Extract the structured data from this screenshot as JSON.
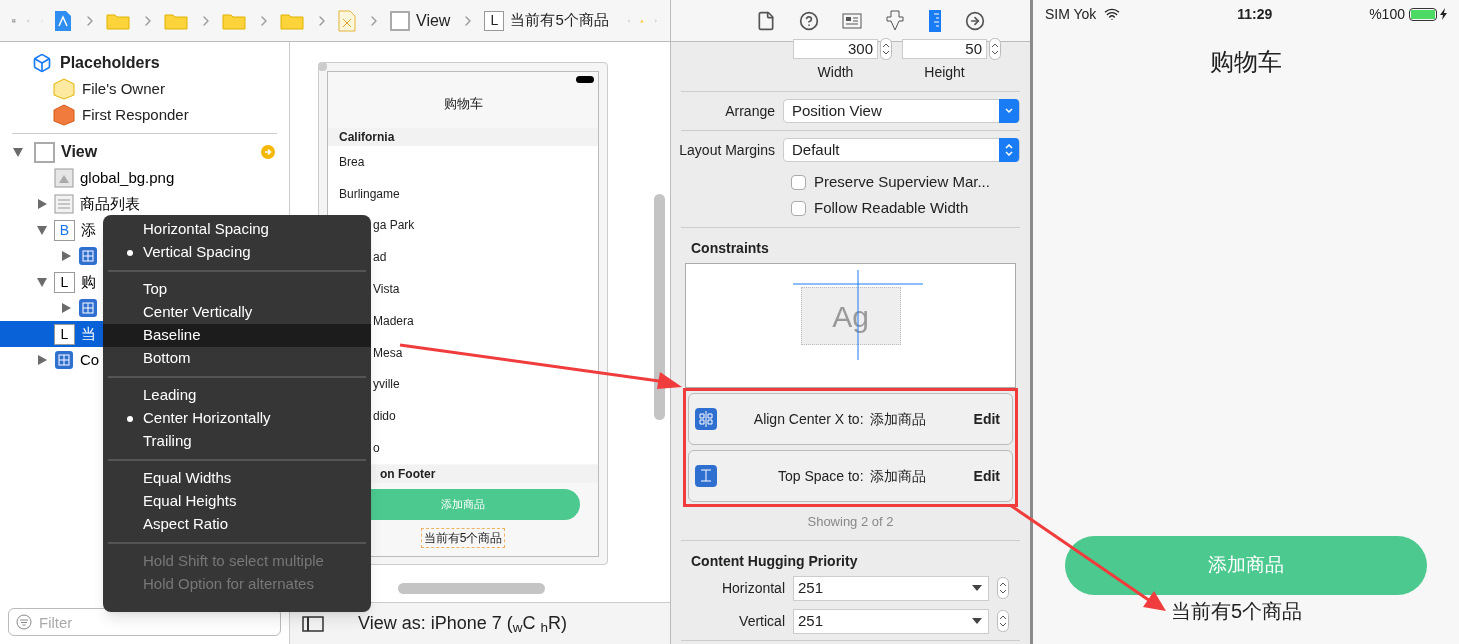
{
  "toolbar": {
    "breadcrumbs": [
      {
        "kind": "project"
      },
      {
        "kind": "folder"
      },
      {
        "kind": "folder"
      },
      {
        "kind": "folder"
      },
      {
        "kind": "folder"
      },
      {
        "kind": "xib"
      },
      {
        "kind": "view",
        "label": "View"
      },
      {
        "kind": "label",
        "badge": "L",
        "label": "当前有5个商品"
      }
    ]
  },
  "outline": {
    "placeholders": {
      "label": "Placeholders",
      "children": [
        {
          "kind": "owner",
          "label": "File's Owner"
        },
        {
          "kind": "responder",
          "label": "First Responder"
        }
      ]
    },
    "view": {
      "label": "View",
      "expanded": true,
      "children": [
        {
          "kind": "image",
          "label": "global_bg.png",
          "selected": false
        },
        {
          "kind": "table",
          "label": "商品列表",
          "expanded": false,
          "selected": false
        },
        {
          "kind": "button",
          "badge": "B",
          "label": "添",
          "expanded": true,
          "selected": false,
          "children": [
            {
              "kind": "constraints",
              "expanded": false,
              "selected": false
            }
          ]
        },
        {
          "kind": "label",
          "badge": "L",
          "label": "购",
          "expanded": true,
          "selected": false,
          "children": [
            {
              "kind": "constraints",
              "expanded": false,
              "selected": false
            }
          ]
        },
        {
          "kind": "label",
          "badge": "L",
          "label": "当",
          "selected": true
        },
        {
          "kind": "constraints",
          "label": "Co",
          "expanded": false,
          "selected": false
        }
      ]
    },
    "filter": {
      "placeholder": "Filter"
    }
  },
  "canvas": {
    "title": "购物车",
    "section_header": "California",
    "rows": [
      {
        "kind": "full",
        "text": "Brea"
      },
      {
        "kind": "full",
        "text": "Burlingame"
      },
      {
        "kind": "cut",
        "text": "ga Park"
      },
      {
        "kind": "cut",
        "text": "ad"
      },
      {
        "kind": "cut",
        "text": "Vista"
      },
      {
        "kind": "cut",
        "text": "Madera"
      },
      {
        "kind": "cut",
        "text": "Mesa"
      },
      {
        "kind": "cut",
        "text": "yville"
      },
      {
        "kind": "cut",
        "text": "dido"
      },
      {
        "kind": "cut",
        "text": "o"
      }
    ],
    "section_footer": "on Footer",
    "button": "添加商品",
    "label": "当前有5个商品",
    "view_as": "View as: iPhone 7 ($_{w}$C $_{h}$R)"
  },
  "menu": {
    "groups": [
      [
        {
          "label": "Horizontal Spacing",
          "checked": false,
          "selected": false
        },
        {
          "label": "Vertical Spacing",
          "checked": true,
          "selected": false
        }
      ],
      [
        {
          "label": "Top",
          "checked": false,
          "selected": false
        },
        {
          "label": "Center Vertically",
          "checked": false,
          "selected": false
        },
        {
          "label": "Baseline",
          "checked": false,
          "selected": true
        },
        {
          "label": "Bottom",
          "checked": false,
          "selected": false
        }
      ],
      [
        {
          "label": "Leading",
          "checked": false,
          "selected": false
        },
        {
          "label": "Center Horizontally",
          "checked": true,
          "selected": false
        },
        {
          "label": "Trailing",
          "checked": false,
          "selected": false
        }
      ],
      [
        {
          "label": "Equal Widths",
          "checked": false,
          "selected": false
        },
        {
          "label": "Equal Heights",
          "checked": false,
          "selected": false
        },
        {
          "label": "Aspect Ratio",
          "checked": false,
          "selected": false
        }
      ]
    ],
    "hints": [
      "Hold Shift to select multiple",
      "Hold Option for alternates"
    ]
  },
  "inspector": {
    "tabs": [
      {
        "kind": "file",
        "selected": false
      },
      {
        "kind": "help",
        "selected": false
      },
      {
        "kind": "identity",
        "selected": false
      },
      {
        "kind": "attributes",
        "selected": false
      },
      {
        "kind": "size",
        "selected": true
      },
      {
        "kind": "connections",
        "selected": false
      }
    ],
    "width": {
      "value": "300",
      "label": "Width"
    },
    "height": {
      "value": "50",
      "label": "Height"
    },
    "arrange": {
      "label": "Arrange",
      "value": "Position View"
    },
    "layout_margins": {
      "label": "Layout Margins",
      "value": "Default"
    },
    "checkboxes": [
      {
        "label": "Preserve Superview Mar...",
        "checked": false
      },
      {
        "label": "Follow Readable Width",
        "checked": false
      }
    ],
    "constraints_title": "Constraints",
    "preview_text": "Ag",
    "constraints": [
      {
        "kind": "center_x",
        "text": "Align Center X to:",
        "target": "添加商品",
        "action": "Edit"
      },
      {
        "kind": "top_space",
        "text": "Top Space to:",
        "target": "添加商品",
        "action": "Edit"
      }
    ],
    "showing": "Showing 2 of 2",
    "hugging": {
      "title": "Content Hugging Priority",
      "rows": [
        {
          "label": "Horizontal",
          "value": "251"
        },
        {
          "label": "Vertical",
          "value": "251"
        }
      ]
    }
  },
  "simulator": {
    "carrier": "SIM Yok",
    "time": "11:29",
    "battery": "%100",
    "title": "购物车",
    "button": "添加商品",
    "label": "当前有5个商品"
  }
}
